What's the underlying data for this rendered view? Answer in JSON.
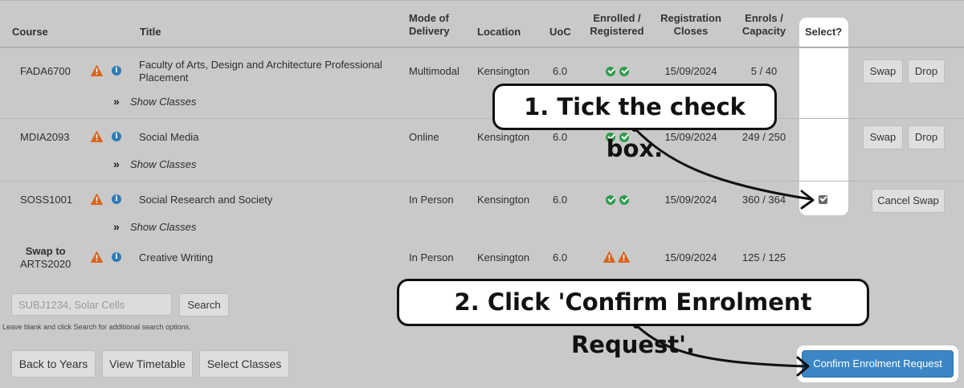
{
  "table": {
    "headers": {
      "course": "Course",
      "title": "Title",
      "mode_line1": "Mode of",
      "mode_line2": "Delivery",
      "location": "Location",
      "uoc": "UoC",
      "enrolled_line1": "Enrolled /",
      "enrolled_line2": "Registered",
      "closes_line1": "Registration",
      "closes_line2": "Closes",
      "enrols_line1": "Enrols /",
      "enrols_line2": "Capacity",
      "select": "Select?"
    },
    "rows": [
      {
        "course": "FADA6700",
        "title_line1": "Faculty of Arts, Design and Architecture Professional",
        "title_line2": "Placement",
        "mode": "Multimodal",
        "location": "Kensington",
        "uoc": "6.0",
        "closes": "15/09/2024",
        "enrols": "5 / 40",
        "show_classes": "Show Classes",
        "btn_swap": "Swap",
        "btn_drop": "Drop"
      },
      {
        "course": "MDIA2093",
        "title": "Social Media",
        "mode": "Online",
        "location": "Kensington",
        "uoc": "6.0",
        "closes": "15/09/2024",
        "enrols": "249 / 250",
        "show_classes": "Show Classes",
        "btn_swap": "Swap",
        "btn_drop": "Drop"
      },
      {
        "course": "SOSS1001",
        "title": "Social Research and Society",
        "mode": "In Person",
        "location": "Kensington",
        "uoc": "6.0",
        "closes": "15/09/2024",
        "enrols": "360 / 364",
        "show_classes": "Show Classes",
        "btn_cancel_swap": "Cancel Swap",
        "checked": true
      },
      {
        "course_line1": "Swap to",
        "course_line2": "ARTS2020",
        "title": "Creative Writing",
        "mode": "In Person",
        "location": "Kensington",
        "uoc": "6.0",
        "closes": "15/09/2024",
        "enrols": "125 / 125"
      }
    ]
  },
  "search": {
    "placeholder": "SUBJ1234, Solar Cells",
    "button": "Search",
    "hint": "Leave blank and click Search for additional search options."
  },
  "footer": {
    "back": "Back to Years",
    "timetable": "View Timetable",
    "select_classes": "Select Classes",
    "confirm": "Confirm Enrolment Request"
  },
  "callouts": {
    "step1": "1. Tick the check box.",
    "step2": "2. Click 'Confirm Enrolment Request'."
  },
  "colors": {
    "background": "#c9c9c9",
    "warning": "#d9641e",
    "info": "#2f7ab8",
    "success": "#2e9c4c",
    "primary_button": "#3b86c5"
  }
}
